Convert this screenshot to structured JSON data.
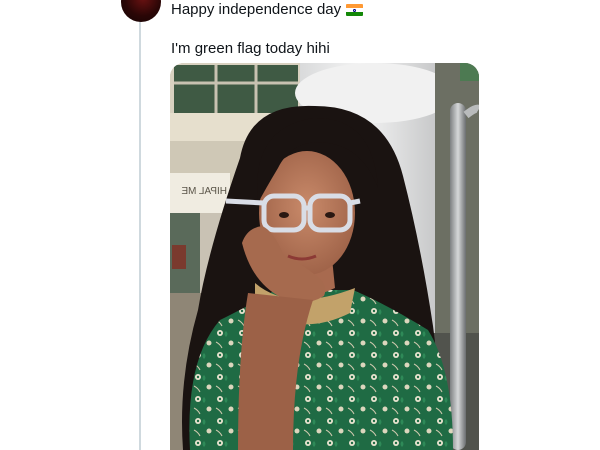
{
  "post": {
    "avatar_color": "#3b0808",
    "line1": "Happy independence day",
    "flag_icon": "india-flag-emoji",
    "line2": "I'm green flag today hihi",
    "photo_sign_text": "HIPAL ME"
  },
  "colors": {
    "text": "#0f1419",
    "thread_line": "#cfd9de",
    "kurta_green": "#1f6b44"
  }
}
